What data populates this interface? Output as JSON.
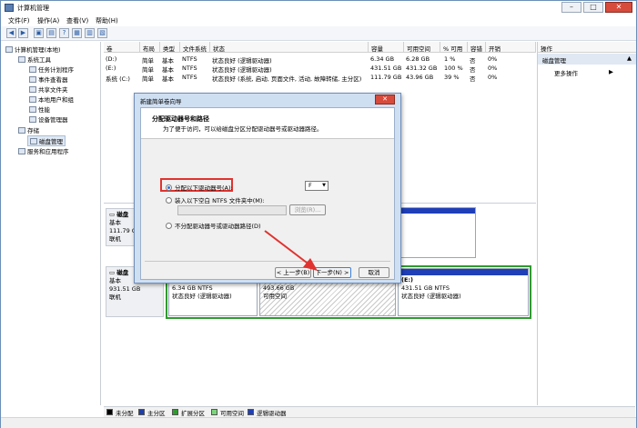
{
  "window": {
    "title": "计算机管理"
  },
  "menu": [
    "文件(F)",
    "操作(A)",
    "查看(V)",
    "帮助(H)"
  ],
  "tree": {
    "root": "计算机管理(本地)",
    "items": [
      "系统工具",
      "任务计划程序",
      "事件查看器",
      "共享文件夹",
      "本地用户和组",
      "性能",
      "设备管理器",
      "存储",
      "磁盘管理",
      "服务和应用程序"
    ],
    "selected": "磁盘管理"
  },
  "table": {
    "columns": [
      "卷",
      "布局",
      "类型",
      "文件系统",
      "状态",
      "容量",
      "可用空间",
      "% 可用",
      "容错",
      "开销"
    ],
    "rows": [
      [
        "(D:)",
        "简单",
        "基本",
        "NTFS",
        "状态良好 (逻辑驱动器)",
        "6.34 GB",
        "6.28 GB",
        "1 %",
        "否",
        "0%"
      ],
      [
        "(E:)",
        "简单",
        "基本",
        "NTFS",
        "状态良好 (逻辑驱动器)",
        "431.51 GB",
        "431.32 GB",
        "100 %",
        "否",
        "0%"
      ],
      [
        "系统 (C:)",
        "简单",
        "基本",
        "NTFS",
        "状态良好 (系统, 启动, 页面文件, 活动, 故障转储, 主分区)",
        "111.79 GB",
        "43.96 GB",
        "39 %",
        "否",
        "0%"
      ]
    ]
  },
  "actions": {
    "header": "操作",
    "selected": "磁盘管理",
    "more": "更多操作"
  },
  "disks": [
    {
      "name": "磁盘",
      "type": "基本",
      "size": "111.79 GB",
      "status": "联机"
    },
    {
      "name": "磁盘",
      "type": "基本",
      "size": "931.51 GB",
      "status": "联机"
    }
  ],
  "partitions": {
    "d": {
      "size": "6.34 GB NTFS",
      "status": "状态良好 (逻辑驱动器)"
    },
    "free": {
      "size": "493.66 GB",
      "status": "可用空间"
    },
    "e": {
      "name": "(E:)",
      "size": "431.51 GB NTFS",
      "status": "状态良好 (逻辑驱动器)"
    }
  },
  "legend": [
    "未分配",
    "主分区",
    "扩展分区",
    "可用空间",
    "逻辑驱动器"
  ],
  "legend_colors": [
    "#000000",
    "#1f3fa8",
    "#2f9b2f",
    "#7ad67a",
    "#1f3fb8"
  ],
  "dialog": {
    "title": "新建简单卷向导",
    "heading": "分配驱动器号和路径",
    "subheading": "为了便于访问，可以给磁盘分区分配驱动器号或驱动器路径。",
    "opt1": "分配以下驱动器号(A):",
    "drive_letter": "F",
    "opt2": "装入以下空白 NTFS 文件夹中(M):",
    "browse": "浏览(R)...",
    "opt3": "不分配驱动器号或驱动器路径(D)",
    "back": "< 上一步(B)",
    "next": "下一步(N) >",
    "cancel": "取消"
  }
}
